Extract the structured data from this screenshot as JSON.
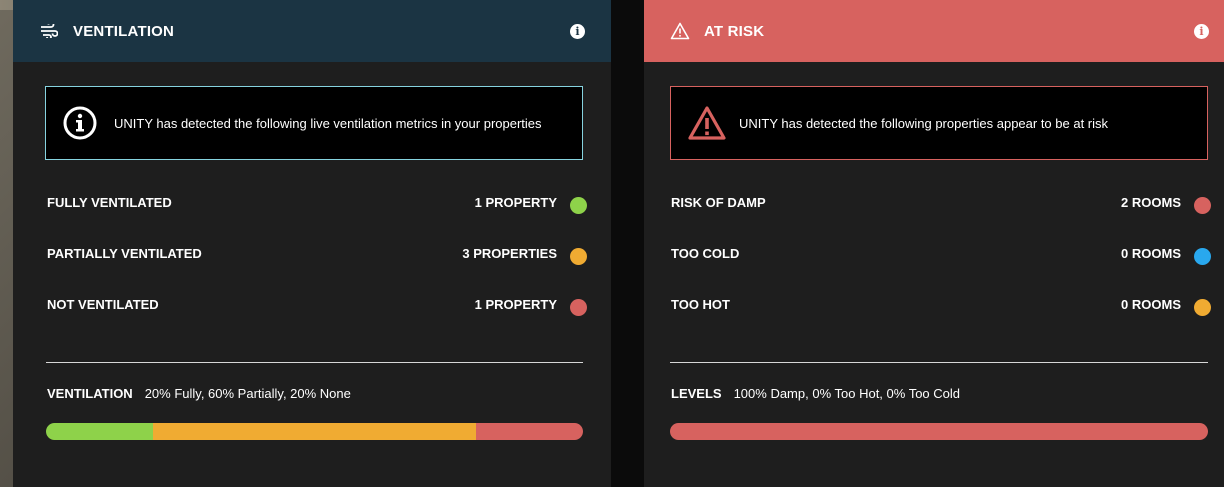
{
  "colors": {
    "green": "#8ed24a",
    "amber": "#f0ab32",
    "red": "#d7625f",
    "blue": "#29a8ee"
  },
  "ventilation": {
    "header": {
      "title": "VENTILATION",
      "icon": "airflow-icon",
      "info_icon": "info-icon"
    },
    "notice": {
      "icon": "info-circle-icon",
      "text": "UNITY has detected the following live ventilation metrics in your properties"
    },
    "metrics": [
      {
        "label": "FULLY VENTILATED",
        "value": "1 PROPERTY",
        "color": "#8ed24a"
      },
      {
        "label": "PARTIALLY VENTILATED",
        "value": "3 PROPERTIES",
        "color": "#f0ab32"
      },
      {
        "label": "NOT VENTILATED",
        "value": "1 PROPERTY",
        "color": "#d7625f"
      }
    ],
    "summary": {
      "label": "VENTILATION",
      "text": "20% Fully, 60% Partially, 20% None"
    },
    "bar": [
      {
        "percent": 20,
        "color": "#8ed24a"
      },
      {
        "percent": 60,
        "color": "#f0ab32"
      },
      {
        "percent": 20,
        "color": "#d7625f"
      }
    ]
  },
  "at_risk": {
    "header": {
      "title": "AT RISK",
      "icon": "warning-icon",
      "info_icon": "info-icon"
    },
    "notice": {
      "icon": "warning-triangle-icon",
      "text": "UNITY has detected the following properties appear to be at risk"
    },
    "metrics": [
      {
        "label": "RISK OF DAMP",
        "value": "2 ROOMS",
        "color": "#d7625f"
      },
      {
        "label": "TOO COLD",
        "value": "0 ROOMS",
        "color": "#29a8ee"
      },
      {
        "label": "TOO HOT",
        "value": "0 ROOMS",
        "color": "#f0ab32"
      }
    ],
    "summary": {
      "label": "LEVELS",
      "text": "100% Damp, 0% Too Hot, 0% Too Cold"
    },
    "bar": [
      {
        "percent": 100,
        "color": "#d7625f"
      }
    ]
  }
}
